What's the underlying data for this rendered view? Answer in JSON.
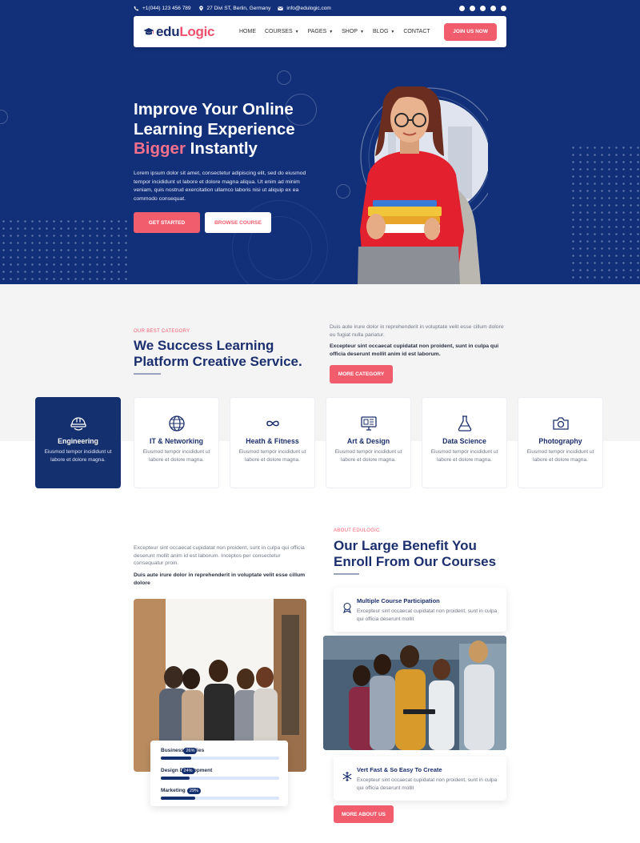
{
  "topbar": {
    "phone": "+1(044) 123 456 789",
    "address": "27 Divi ST, Berlin, Germany",
    "email": "info@edulogic.com",
    "social_icons": [
      "facebook-icon",
      "twitter-icon",
      "youtube-icon",
      "instagram-icon",
      "linkedin-icon"
    ]
  },
  "nav": {
    "logo_prefix": "edu",
    "logo_suffix": "Logic",
    "items": [
      {
        "label": "HOME",
        "dropdown": false
      },
      {
        "label": "COURSES",
        "dropdown": true
      },
      {
        "label": "PAGES",
        "dropdown": true
      },
      {
        "label": "SHOP",
        "dropdown": true
      },
      {
        "label": "BLOG",
        "dropdown": true
      },
      {
        "label": "CONTACT",
        "dropdown": false
      }
    ],
    "cta": "JOIN US NOW"
  },
  "hero": {
    "title_line1": "Improve Your Online",
    "title_line2": "Learning Experience",
    "title_highlight": "Bigger",
    "title_rest": " Instantly",
    "text": "Lorem ipsum dolor sit amet, consectetur adipiscing elit, sed do eiusmod tempor incididunt ut labore et dolore magna aliqua. Ut enim ad minim veniam, quis nostrud exercitation ullamco laboris nisi ut aliquip ex ea commodo consequat.",
    "btn_primary": "GET STARTED",
    "btn_secondary": "BROWSE COURSE"
  },
  "category": {
    "eyebrow": "OUR BEST CATEGORY",
    "title_line1": "We Success Learning",
    "title_line2": "Platform Creative Service.",
    "text": "Duis aute irure dolor in reprehenderit in voluptate velit esse cillum dolore eu fugiat nulla pariatur.",
    "text_bold": "Excepteur sint occaecat cupidatat non proident, sunt in culpa qui officia deserunt mollit anim id est laborum.",
    "button": "MORE CATEGORY",
    "cards": [
      {
        "title": "Engineering",
        "desc": "Eiusmod tempor incididunt ut labore et dolore magna.",
        "icon": "engineer-helmet-icon",
        "active": true
      },
      {
        "title": "IT & Networking",
        "desc": "Eiusmod tempor incididunt ut labore et dolore magna.",
        "icon": "globe-icon",
        "active": false
      },
      {
        "title": "Heath & Fitness",
        "desc": "Eiusmod tempor incididunt ut labore et dolore magna.",
        "icon": "infinity-icon",
        "active": false
      },
      {
        "title": "Art & Design",
        "desc": "Eiusmod tempor incididunt ut labore et dolore magna.",
        "icon": "monitor-design-icon",
        "active": false
      },
      {
        "title": "Data Science",
        "desc": "Eiusmod tempor incididunt ut labore et dolore magna.",
        "icon": "flask-icon",
        "active": false
      },
      {
        "title": "Photography",
        "desc": "Eiusmod tempor incididunt ut labore et dolore magna.",
        "icon": "camera-icon",
        "active": false
      }
    ]
  },
  "about": {
    "text": "Excepteur sint occaecat cupidatat non proident, sunt in culpa qui officia deserunt mollit anim id est laborum. Inceptos per consectetur consequatur proin.",
    "text_bold": "Duis aute irure dolor in reprehenderit in voluptate velit esse cillum dolore",
    "eyebrow": "ABOUT EDULOGIC",
    "title_line1": "Our Large Benefit You",
    "title_line2": "Enroll From Our Courses",
    "progress": [
      {
        "label": "Business Studies",
        "percent_label": "26%",
        "value": 26
      },
      {
        "label": "Design Development",
        "percent_label": "24%",
        "value": 24
      },
      {
        "label": "Marketing",
        "percent_label": "29%",
        "value": 29
      }
    ],
    "benefits": [
      {
        "title": "Multiple Course Participation",
        "desc": "Excepteur sint occaecat cupidatat non proident, sunt in culpa qui officia deserunt mollit",
        "icon": "award-badge-icon"
      },
      {
        "title": "Vert Fast & So Easy To Create",
        "desc": "Excepteur sint occaecat cupidatat non proident, sunt in culpa qui officia deserunt mollit",
        "icon": "snowflake-icon"
      }
    ],
    "button": "MORE ABOUT US"
  },
  "colors": {
    "navy": "#12307a",
    "accent": "#f25d6e",
    "light_bg": "#f4f4f5"
  }
}
